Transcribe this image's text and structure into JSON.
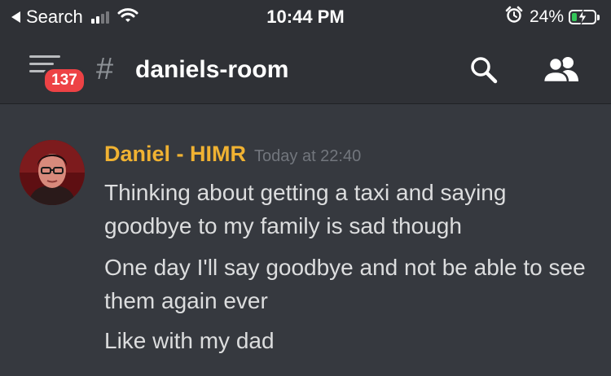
{
  "status_bar": {
    "back_label": "Search",
    "time": "10:44 PM",
    "battery_percent": "24%",
    "battery_level": 0.24,
    "signal_bars_active": 2,
    "signal_bars_total": 4
  },
  "header": {
    "notification_count": "137",
    "channel_hash": "#",
    "channel_name": "daniels-room",
    "icons": [
      "menu-icon",
      "search-icon",
      "members-icon"
    ]
  },
  "message": {
    "author": "Daniel - HIMR",
    "author_color": "#f0b232",
    "timestamp": "Today at 22:40",
    "lines": [
      "Thinking about getting a taxi and saying goodbye to my family is sad though",
      "One day I'll say goodbye and not be able to see them again ever",
      "Like with my dad"
    ]
  },
  "colors": {
    "background": "#36393f",
    "header_bg": "#2f3136",
    "badge": "#ed4245",
    "battery_fill": "#34c759"
  }
}
